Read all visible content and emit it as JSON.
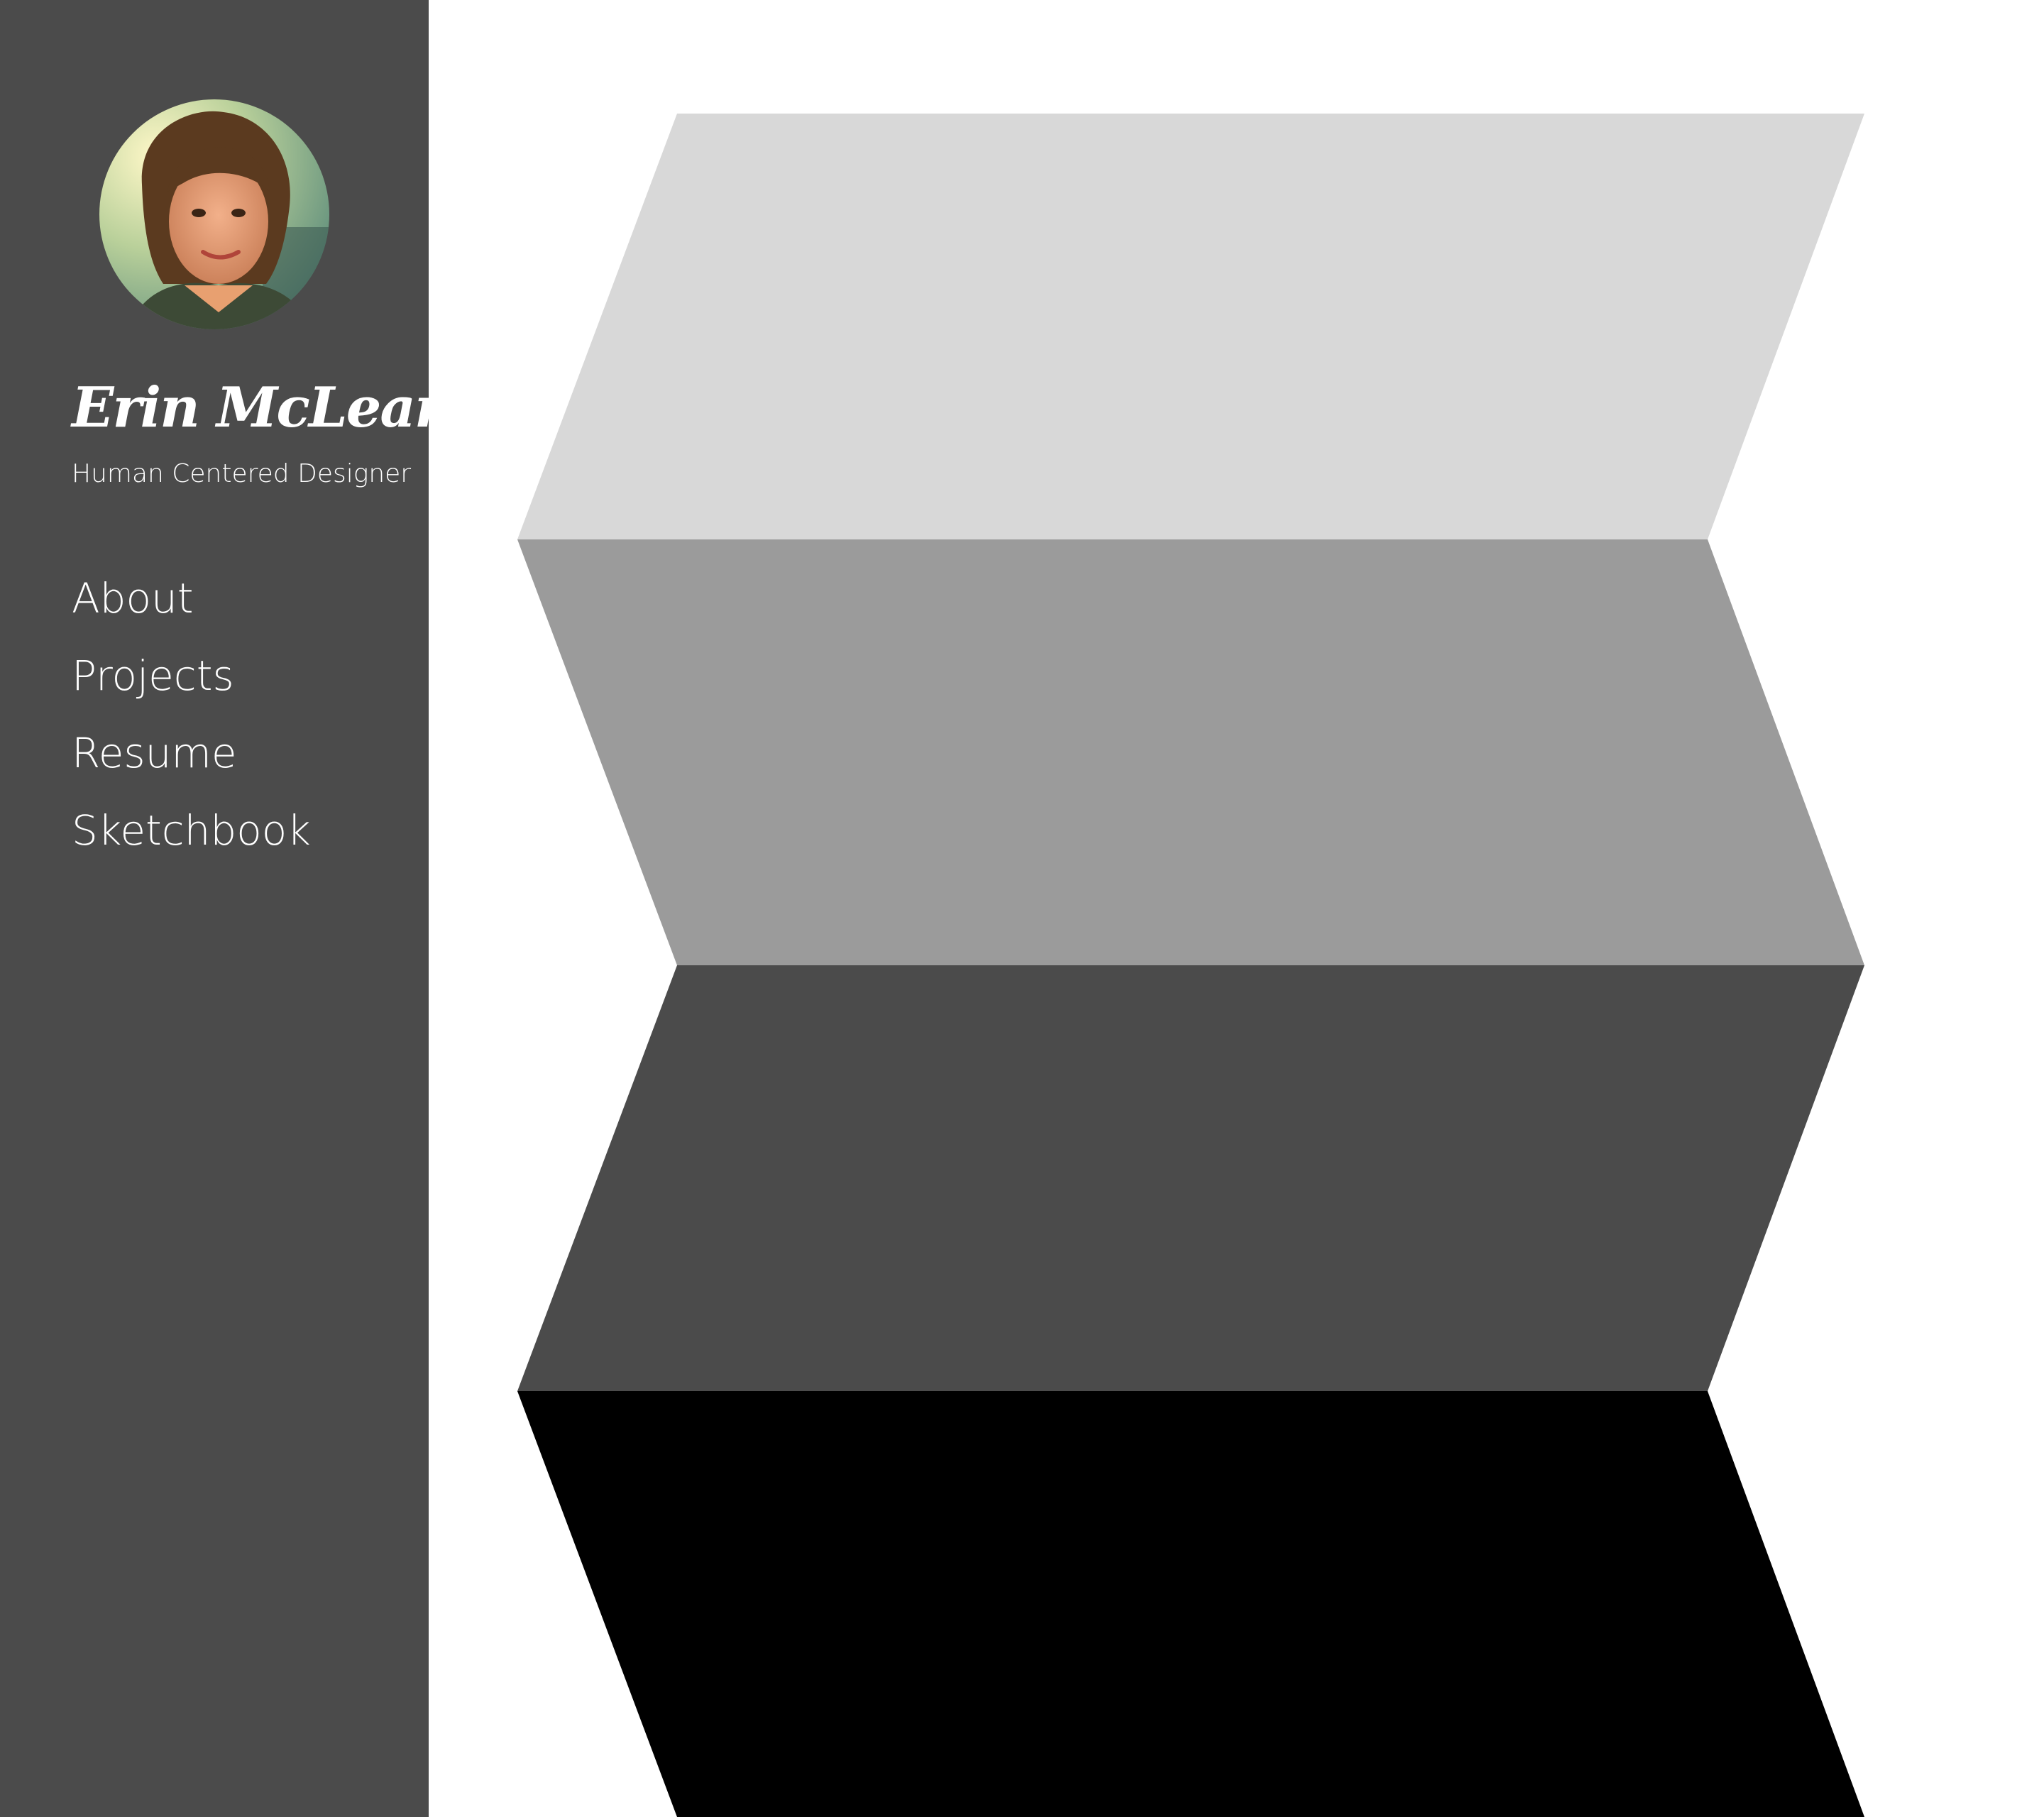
{
  "profile": {
    "name": "Erin McLean",
    "tagline": "Human Centered Designer",
    "avatar_icon": "profile-photo"
  },
  "nav": {
    "items": [
      {
        "label": "About"
      },
      {
        "label": "Projects"
      },
      {
        "label": "Resume"
      },
      {
        "label": "Sketchbook"
      }
    ]
  },
  "colors": {
    "sidebar_bg": "#4b4b4b",
    "main_bg": "#ffffff",
    "panels": [
      "#d8d8d8",
      "#9b9b9b",
      "#4b4b4b",
      "#000000"
    ]
  }
}
